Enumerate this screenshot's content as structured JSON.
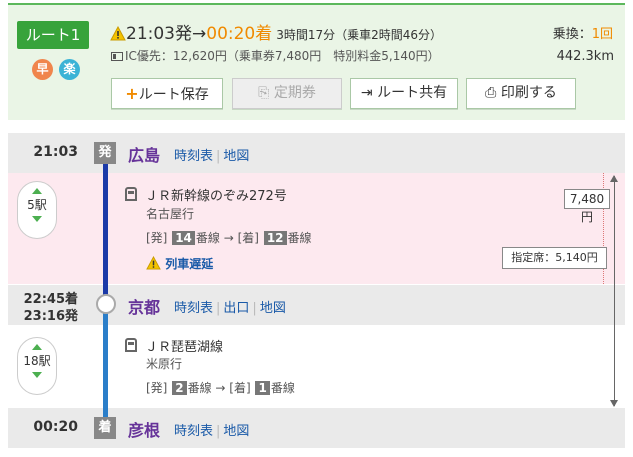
{
  "summary": {
    "route_label": "ルート1",
    "tag_fast": "早",
    "tag_easy": "楽",
    "depart_time": "21:03発",
    "arrive_time": "00:20着",
    "duration": "3時間17分（乗車2時間46分）",
    "fare_text": "IC優先：12,620円（乗車券7,480円　特別料金5,140円）",
    "transfer_label": "乗換：",
    "transfer_count": "1回",
    "distance": "442.3km",
    "buttons": {
      "save": "ルート保存",
      "pass": "定期券",
      "share": "ルート共有",
      "print": "印刷する"
    }
  },
  "stations": [
    {
      "time": "21:03",
      "mark": "発",
      "name": "広島",
      "links": [
        "時刻表",
        "地図"
      ]
    },
    {
      "time_arr": "22:45着",
      "time_dep": "23:16発",
      "name": "京都",
      "links": [
        "時刻表",
        "出口",
        "地図"
      ]
    },
    {
      "time": "00:20",
      "mark": "着",
      "name": "彦根",
      "links": [
        "時刻表",
        "地図"
      ]
    }
  ],
  "segments": [
    {
      "stops": "5駅",
      "line": "ＪＲ新幹線のぞみ272号",
      "dest": "名古屋行",
      "plat_dep_label": "[発]",
      "plat_dep": "14",
      "plat_arr_label": "[着]",
      "plat_arr": "12",
      "plat_unit": "番線",
      "delay": "列車遅延",
      "price": "7,480円",
      "reserved": "指定席：5,140円"
    },
    {
      "stops": "18駅",
      "line": "ＪＲ琵琶湖線",
      "dest": "米原行",
      "plat_dep_label": "[発]",
      "plat_dep": "2",
      "plat_arr_label": "[着]",
      "plat_arr": "1",
      "plat_unit": "番線"
    }
  ],
  "colors": {
    "accent_green": "#37a33b",
    "arrive_orange": "#f08a00",
    "station_purple": "#663399",
    "link_blue": "#1a5aa8",
    "shinkansen_line": "#1b3aa8",
    "local_line": "#2b7ec9"
  }
}
